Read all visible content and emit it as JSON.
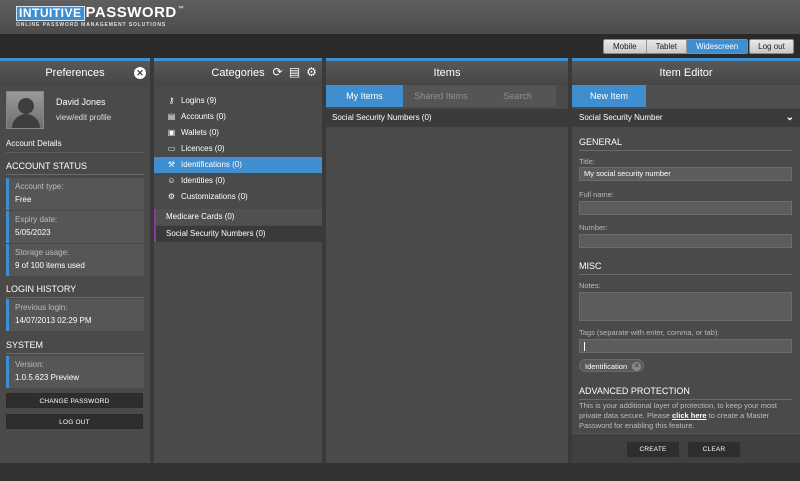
{
  "brand": {
    "logo_part1": "INTUITIVE",
    "logo_part2": "PASSWORD",
    "tm": "™",
    "tagline": "ONLINE PASSWORD MANAGEMENT SOLUTIONS"
  },
  "topbar": {
    "views": [
      "Mobile",
      "Tablet",
      "Widescreen"
    ],
    "active_view": "Widescreen",
    "logout": "Log out"
  },
  "preferences": {
    "title": "Preferences",
    "user_name": "David Jones",
    "user_link": "view/edit profile",
    "account_details": "Account Details",
    "account_status_h": "ACCOUNT STATUS",
    "account_type_label": "Account type:",
    "account_type_value": "Free",
    "expiry_label": "Expiry date:",
    "expiry_value": "5/05/2023",
    "storage_label": "Storage usage:",
    "storage_value": "9 of 100 items used",
    "login_history_h": "LOGIN HISTORY",
    "prev_login_label": "Previous login:",
    "prev_login_value": "14/07/2013 02:29 PM",
    "system_h": "SYSTEM",
    "version_label": "Version:",
    "version_value": "1.0.5.623 Preview",
    "change_password": "CHANGE PASSWORD",
    "log_out": "LOG OUT"
  },
  "categories": {
    "title": "Categories",
    "items": [
      {
        "label": "Logins (9)",
        "icon": "key-icon"
      },
      {
        "label": "Accounts (0)",
        "icon": "book-icon"
      },
      {
        "label": "Wallets (0)",
        "icon": "wallet-icon"
      },
      {
        "label": "Licences (0)",
        "icon": "card-icon"
      },
      {
        "label": "Identifications (0)",
        "icon": "gavel-icon"
      },
      {
        "label": "Identities (0)",
        "icon": "people-icon"
      },
      {
        "label": "Customizations (0)",
        "icon": "gears-icon"
      }
    ],
    "active_index": 4,
    "subitems": [
      "Medicare Cards (0)",
      "Social Security Numbers (0)"
    ]
  },
  "items": {
    "title": "Items",
    "tabs": [
      "My Items",
      "Shared Items",
      "Search"
    ],
    "row": "Social Security Numbers (0)"
  },
  "editor": {
    "title": "Item Editor",
    "tab": "New Item",
    "type": "Social Security Number",
    "general_h": "GENERAL",
    "title_label": "Title:",
    "title_value": "My social security number",
    "fullname_label": "Full name:",
    "number_label": "Number:",
    "misc_h": "MISC",
    "notes_label": "Notes:",
    "tags_label": "Tags (separate with enter, comma, or tab):",
    "tag": "Identification",
    "adv_h": "ADVANCED PROTECTION",
    "adv_desc_1": "This is your additional layer of protection, to keep your most private data secure. Please ",
    "adv_link": "click here",
    "adv_desc_2": " to create a Master Password for enabling this feature.",
    "create": "CREATE",
    "clear": "CLEAR"
  },
  "colors": {
    "accent": "#3f8ed0",
    "subcategory_marker": "#8a3aa0"
  }
}
